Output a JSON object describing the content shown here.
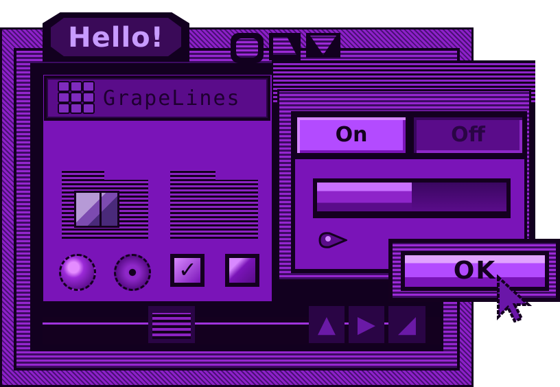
{
  "window": {
    "title": "Hello!"
  },
  "panel": {
    "title": "GrapeLines"
  },
  "dialog": {
    "segments": [
      {
        "label": "On",
        "selected": true
      },
      {
        "label": "Off",
        "selected": false
      }
    ],
    "progress": 0.5,
    "ok_label": "OK"
  },
  "checkboxes": [
    {
      "checked": true
    },
    {
      "checked": false
    }
  ],
  "colors": {
    "accent": "#7a14b8",
    "dark": "#12001f",
    "highlight": "#b34bff"
  },
  "icons": [
    "grid-icon",
    "finder-icon",
    "folder-icon",
    "cursor-icon",
    "pointer-icon",
    "scroll-up-icon",
    "scroll-down-icon",
    "grow-icon"
  ]
}
